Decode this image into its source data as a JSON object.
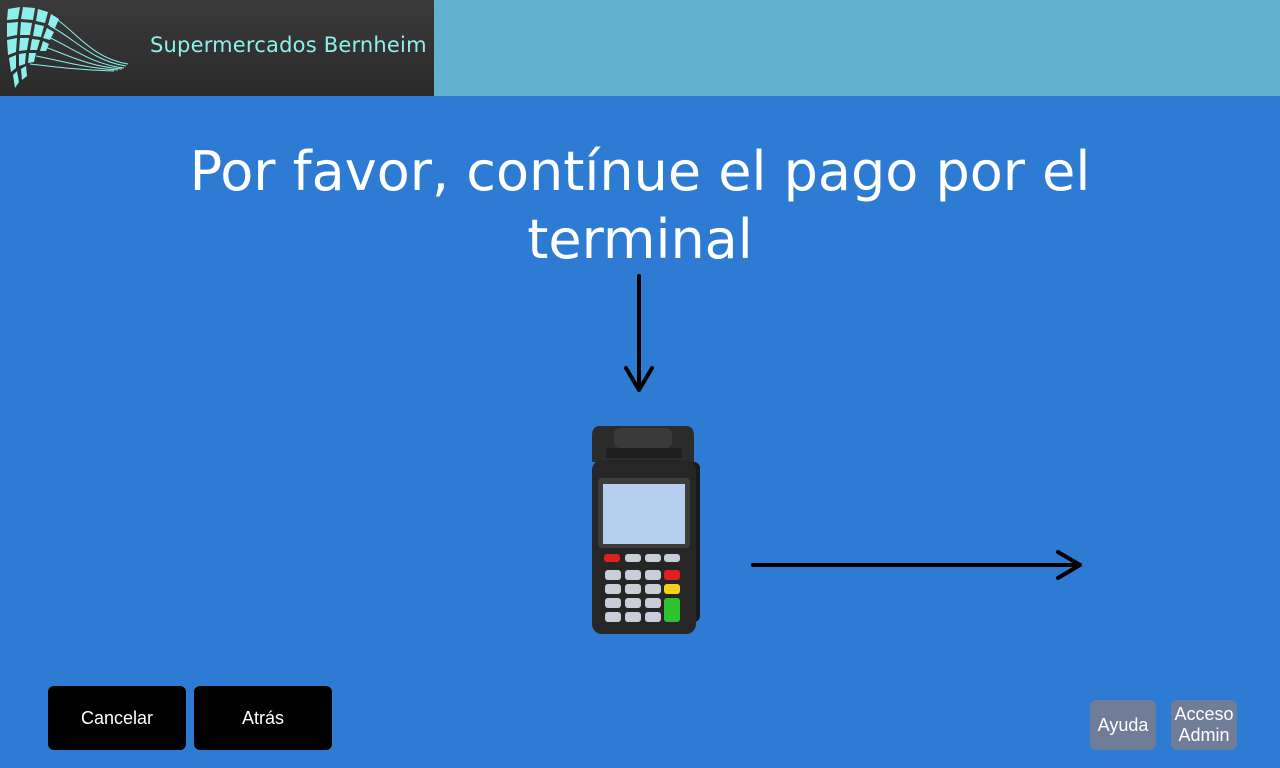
{
  "header": {
    "brand_name": "Supermercados Bernheim",
    "logo_icon": "wave-grid-logo-icon",
    "colors": {
      "bar": "#62b2cf",
      "brand_panel": "#333333",
      "brand_text": "#8ef0ec",
      "logo": "#8ef0ec"
    }
  },
  "main": {
    "instruction": "Por favor, contínue el pago por el terminal",
    "background_color": "#2e7bd4",
    "icons": [
      "arrow-down-icon",
      "card-terminal-icon",
      "arrow-right-icon"
    ]
  },
  "footer": {
    "cancel_label": "Cancelar",
    "back_label": "Atrás",
    "help_label": "Ayuda",
    "admin_label": "Acceso\nAdmin",
    "colors": {
      "primary_button": "#000000",
      "secondary_button": "#6f7d98"
    }
  }
}
